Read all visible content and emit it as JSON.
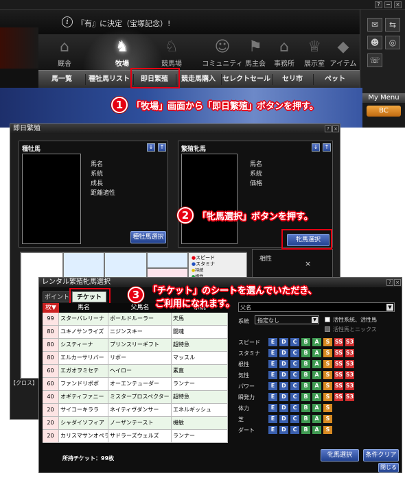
{
  "titlebar": {
    "help": "?",
    "minimize": "−",
    "close": "×"
  },
  "news": {
    "text": "『有』に決定（宝塚記念）!"
  },
  "main_nav": [
    {
      "label": "厩舎",
      "icon": "stable-icon"
    },
    {
      "label": "牧場",
      "icon": "farm-icon"
    },
    {
      "label": "競馬場",
      "icon": "racecourse-icon"
    },
    {
      "label": "コミュニティ",
      "icon": "community-icon"
    },
    {
      "label": "馬主会",
      "icon": "owners-club-icon"
    },
    {
      "label": "事務所",
      "icon": "office-icon"
    },
    {
      "label": "展示室",
      "icon": "trophy-icon"
    },
    {
      "label": "アイテム",
      "icon": "item-icon"
    }
  ],
  "sub_nav": [
    "馬一覧",
    "種牡馬リスト",
    "即日繁殖",
    "競走馬購入",
    "セレクトセール",
    "セリ市",
    "ペット"
  ],
  "my_menu": {
    "title": "My Menu",
    "button": "BC"
  },
  "callouts": {
    "step1": {
      "num": "1",
      "text": "「牧場」画面から「即日繁殖」ボタンを押す。"
    },
    "step2": {
      "num": "2",
      "text": "「牝馬選択」ボタンを押す。"
    },
    "step3": {
      "num": "3",
      "line1": "「チケット」のシートを選んでいただき、",
      "line2": "ご利用になれます。"
    }
  },
  "breed_window": {
    "title": "即日繁殖",
    "stallion": {
      "heading": "種牡馬",
      "fields": [
        "馬名",
        "系統",
        "成長",
        "距離適性"
      ],
      "button": "種牡馬選択"
    },
    "mare": {
      "heading": "繁殖牝馬",
      "fields": [
        "馬名",
        "系統",
        "価格"
      ],
      "button": "牝馬選択"
    },
    "legend": [
      "スピード",
      "スタミナ",
      "持続",
      "根性"
    ],
    "aptitude": {
      "label": "相性",
      "mark": "×"
    },
    "cross_label": "【クロス】"
  },
  "rental_window": {
    "title": "レンタル繁殖牝馬選択",
    "tabs": [
      "ポイント",
      "チケット"
    ],
    "columns": [
      "枚▼",
      "馬名",
      "父馬名",
      "系統"
    ],
    "rows": [
      [
        "99",
        "スターバレリーナ",
        "ボールドルーラー",
        "天馬"
      ],
      [
        "80",
        "ユキノサンライズ",
        "ニジンスキー",
        "闘魂"
      ],
      [
        "80",
        "システィーナ",
        "プリンスリーギフト",
        "超特急"
      ],
      [
        "80",
        "エルカーサリバー",
        "リボー",
        "マッスル"
      ],
      [
        "60",
        "エガオヲミセテ",
        "ヘイロー",
        "素直"
      ],
      [
        "60",
        "ファンドリポポ",
        "オーエンテューダー",
        "ランナー"
      ],
      [
        "40",
        "オギティファニー",
        "ミスタープロスペクター",
        "超特急"
      ],
      [
        "20",
        "サイコーキララ",
        "ネイティヴダンサー",
        "エネルギッシュ"
      ],
      [
        "20",
        "シャダイソフィア",
        "ノーザンテースト",
        "機敏"
      ],
      [
        "20",
        "カリスマサンオペラ",
        "サドラーズウェルズ",
        "ランナー"
      ]
    ],
    "tickets_owned": "所持チケット：99枚",
    "sire_label": "父名",
    "lineage": {
      "label": "系統",
      "selected": "指定なし"
    },
    "checks": [
      "活性系統、活性馬",
      "活性馬とニックス"
    ],
    "stats": [
      "スピード",
      "スタミナ",
      "根性",
      "気性",
      "パワー",
      "瞬発力",
      "体力",
      "芝",
      "ダート"
    ],
    "grades": [
      "E",
      "D",
      "C",
      "B",
      "A",
      "S",
      "SS",
      "S3"
    ],
    "grade_colors": [
      "#3a5fae",
      "#3a5fae",
      "#3a5fae",
      "#3f9a52",
      "#3f9a52",
      "#d88a22",
      "#cf2d2d",
      "#cf2d2d"
    ],
    "buttons": {
      "select": "牝馬選択",
      "clear": "条件クリア",
      "close": "閉じる"
    }
  }
}
